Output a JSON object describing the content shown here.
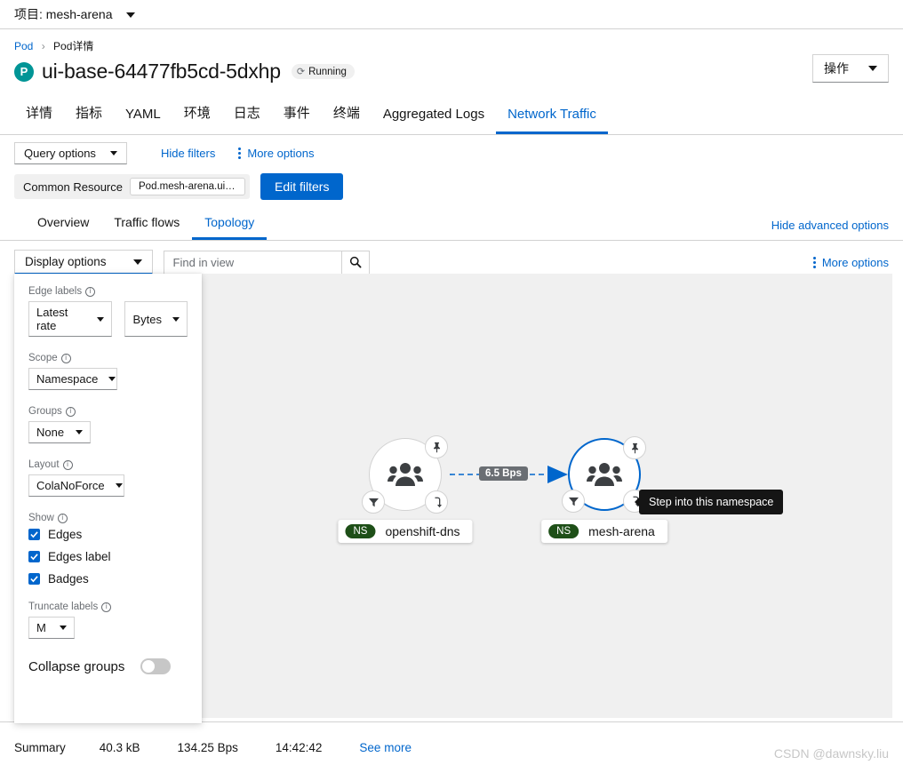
{
  "project_bar": {
    "label": "项目: mesh-arena"
  },
  "header": {
    "breadcrumb_root": "Pod",
    "breadcrumb_sep": "›",
    "breadcrumb_current": "Pod详情",
    "pod_badge": "P",
    "title": "ui-base-64477fb5cd-5dxhp",
    "status": "Running",
    "status_icon": "sync-icon",
    "actions_label": "操作"
  },
  "main_tabs": [
    {
      "label": "详情",
      "active": false
    },
    {
      "label": "指标",
      "active": false
    },
    {
      "label": "YAML",
      "active": false
    },
    {
      "label": "环境",
      "active": false
    },
    {
      "label": "日志",
      "active": false
    },
    {
      "label": "事件",
      "active": false
    },
    {
      "label": "终端",
      "active": false
    },
    {
      "label": "Aggregated Logs",
      "active": false
    },
    {
      "label": "Network Traffic",
      "active": true
    }
  ],
  "query_bar": {
    "query_options": "Query options",
    "hide_filters": "Hide filters",
    "more_options": "More options"
  },
  "filters": {
    "group_label": "Common Resource",
    "chip": "Pod.mesh-arena.ui-base...",
    "edit_button": "Edit filters"
  },
  "sub_tabs": [
    {
      "label": "Overview",
      "active": false
    },
    {
      "label": "Traffic flows",
      "active": false
    },
    {
      "label": "Topology",
      "active": true
    }
  ],
  "advanced_link": "Hide advanced options",
  "display_row": {
    "display_options": "Display options",
    "search_placeholder": "Find in view",
    "search_value": "",
    "search_icon": "magnifier-icon",
    "more_options": "More options"
  },
  "options_panel": {
    "edge_labels": {
      "label": "Edge labels",
      "metric": "Latest rate",
      "unit": "Bytes"
    },
    "scope": {
      "label": "Scope",
      "value": "Namespace"
    },
    "groups": {
      "label": "Groups",
      "value": "None"
    },
    "layout": {
      "label": "Layout",
      "value": "ColaNoForce"
    },
    "show": {
      "label": "Show",
      "items": [
        {
          "label": "Edges",
          "checked": true
        },
        {
          "label": "Edges label",
          "checked": true
        },
        {
          "label": "Badges",
          "checked": true
        }
      ]
    },
    "truncate": {
      "label": "Truncate labels",
      "value": "M"
    },
    "collapse_groups": {
      "label": "Collapse groups",
      "enabled": false
    }
  },
  "topology": {
    "nodes": [
      {
        "id": "openshift-dns",
        "ns_badge": "NS",
        "label": "openshift-dns",
        "selected": false,
        "badges": [
          "pin-icon",
          "filter-icon",
          "step-into-icon"
        ]
      },
      {
        "id": "mesh-arena",
        "ns_badge": "NS",
        "label": "mesh-arena",
        "selected": true,
        "badges": [
          "pin-icon",
          "filter-icon",
          "step-into-icon"
        ]
      }
    ],
    "edge": {
      "label": "6.5 Bps",
      "from": "openshift-dns",
      "to": "mesh-arena"
    },
    "tooltip": "Step into this namespace"
  },
  "footer": {
    "summary": "Summary",
    "bytes": "40.3 kB",
    "rate": "134.25 Bps",
    "time": "14:42:42",
    "see_more": "See more"
  },
  "watermark": "CSDN @dawnsky.liu"
}
